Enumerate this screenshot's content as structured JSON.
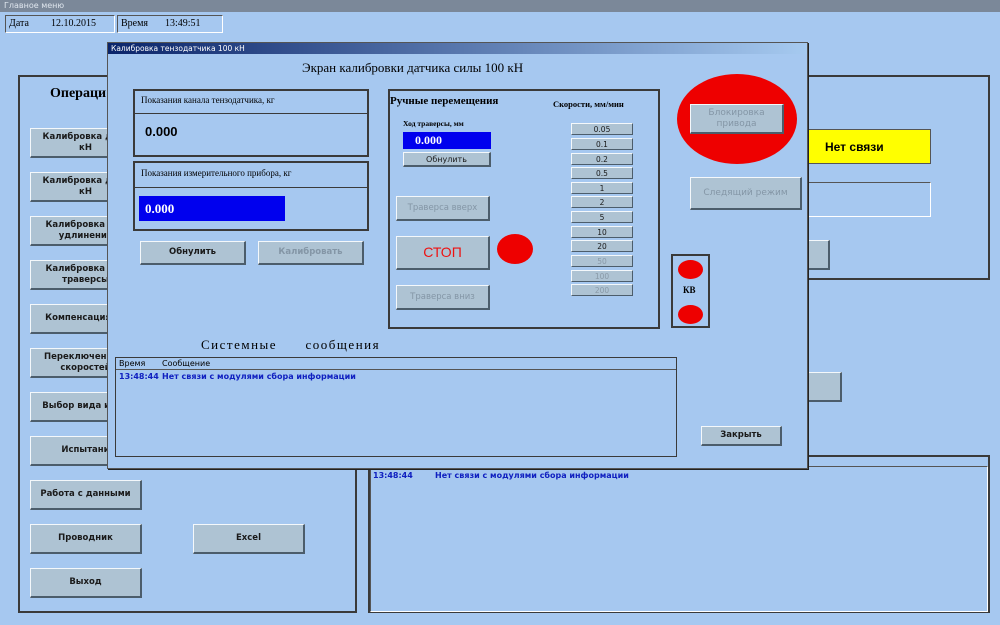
{
  "main_window": {
    "title": "Главное меню",
    "date_label": "Дата",
    "date_value": "12.10.2015",
    "time_label": "Время",
    "time_value": "13:49:51",
    "operations_heading": "Операци",
    "no_link_status": "Нет связи",
    "menu_buttons": [
      "Калибровка датч\nкН",
      "Калибровка датч\nкН",
      "Калибровка дат\nудлинения",
      "Калибровка дат\nтраверсы",
      "Компенсация пр",
      "Переключение к\nскоростей",
      "Выбор вида испы",
      "Испытани",
      "Работа с данными",
      "Проводник",
      "Выход"
    ],
    "excel_button": "Excel",
    "log": {
      "time": "13:48:44",
      "message": "Нет связи с модулями сбора информации"
    }
  },
  "dialog": {
    "title": "Калибровка тензодатчика 100 кН",
    "heading": "Экран калибровки датчика силы  100 кН",
    "channel_label": "Показания канала тензодатчика, кг",
    "channel_value": "0.000",
    "instrument_label": "Показания измерительного прибора, кг",
    "instrument_value": "0.000",
    "reset_button": "Обнулить",
    "calibrate_button": "Калибровать",
    "manual": {
      "heading": "Ручные перемещения",
      "speeds_heading": "Скорости, мм/мин",
      "travel_label": "Ход траверсы, мм",
      "travel_value": "0.000",
      "reset_button": "Обнулить",
      "up_button": "Траверса вверх",
      "stop_button": "СТОП",
      "down_button": "Траверса вниз",
      "speeds": [
        "0.05",
        "0.1",
        "0.2",
        "0.5",
        "1",
        "2",
        "5",
        "10",
        "20",
        "50",
        "100",
        "200"
      ]
    },
    "drive_block_button": "Блокировка\nпривода",
    "tracking_button": "Следящий режим",
    "kv_label": "КВ",
    "system_messages_heading": "Системные      сообщения",
    "messages": {
      "col_time": "Время",
      "col_message": "Сообщение",
      "rows": [
        {
          "time": "13:48:44",
          "message": "Нет связи с модулями сбора информации"
        }
      ]
    },
    "close_button": "Закрыть"
  }
}
